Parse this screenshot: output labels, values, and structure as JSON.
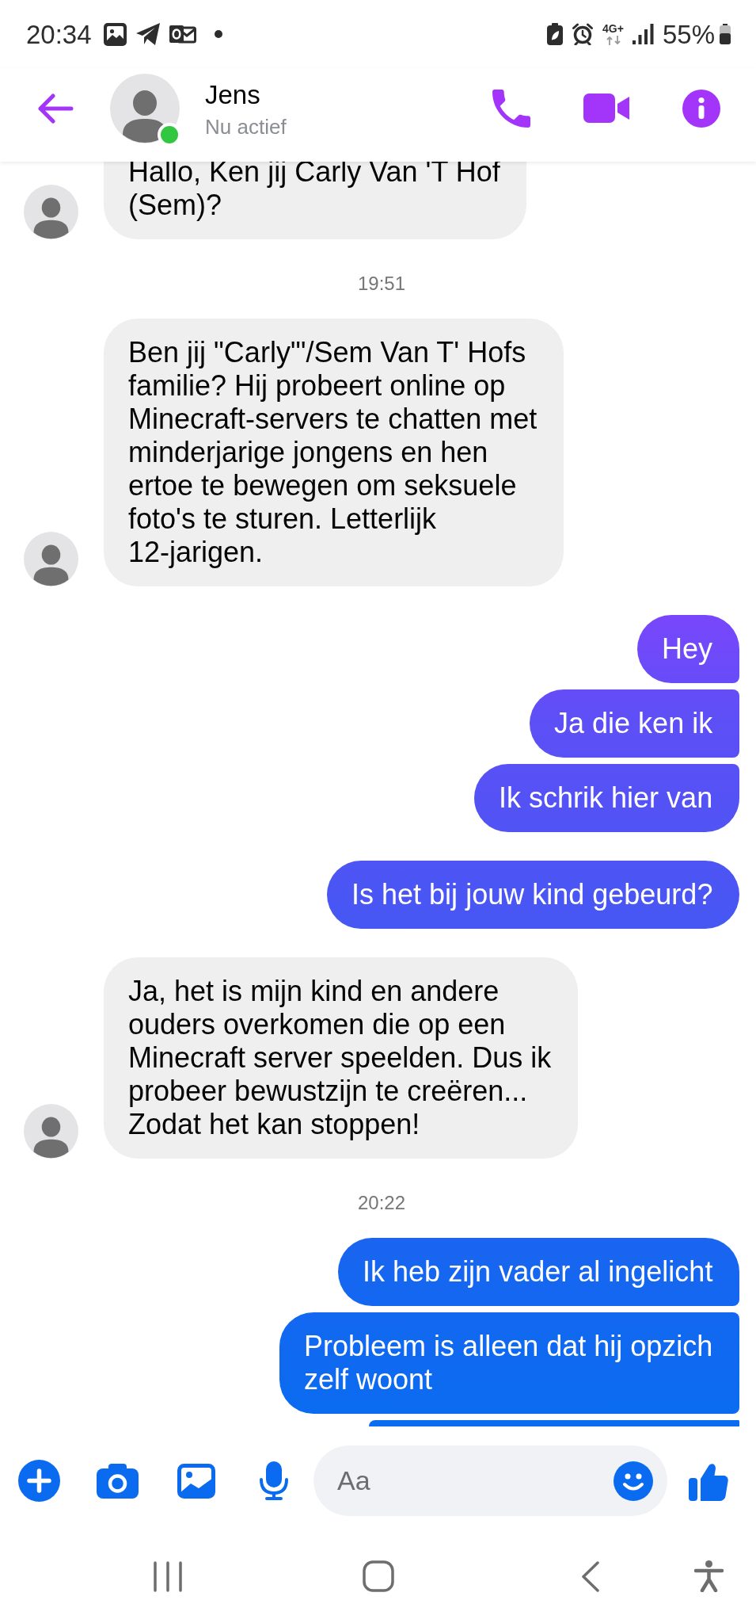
{
  "status_bar": {
    "time": "20:34",
    "network": "4G+",
    "battery": "55%"
  },
  "header": {
    "name": "Jens",
    "status": "Nu actief",
    "online": true
  },
  "thread": [
    {
      "kind": "incoming",
      "bubbles": [
        {
          "text": "Hallo, Ken jij Carly Van 'T Hof (Sem)?",
          "cut_top": true
        }
      ]
    },
    {
      "kind": "timestamp",
      "text": "19:51"
    },
    {
      "kind": "incoming",
      "bubbles": [
        {
          "text": "Ben jij \"Carly\"'/Sem Van T' Hofs familie? Hij probeert online op Minecraft-servers te chatten met minderjarige jongens en hen ertoe te bewegen om seksuele foto's te sturen. Letterlijk 12-jarigen."
        }
      ]
    },
    {
      "kind": "outgoing",
      "bubbles": [
        {
          "text": "Hey"
        },
        {
          "text": "Ja die ken ik"
        },
        {
          "text": "Ik schrik hier van"
        }
      ]
    },
    {
      "kind": "outgoing",
      "bubbles": [
        {
          "text": "Is het bij jouw kind gebeurd?"
        }
      ]
    },
    {
      "kind": "incoming",
      "bubbles": [
        {
          "text": "Ja, het is mijn kind en andere ouders overkomen die op een Minecraft server speelden. Dus ik probeer bewustzijn te creëren... Zodat het kan stoppen!"
        }
      ]
    },
    {
      "kind": "timestamp",
      "text": "20:22"
    },
    {
      "kind": "outgoing",
      "bubbles": [
        {
          "text": "Ik heb zijn vader al ingelicht"
        },
        {
          "text": "Probleem is alleen dat hij opzich zelf woont"
        },
        {
          "cut_bottom": true
        }
      ]
    }
  ],
  "composer": {
    "placeholder": "Aa"
  }
}
